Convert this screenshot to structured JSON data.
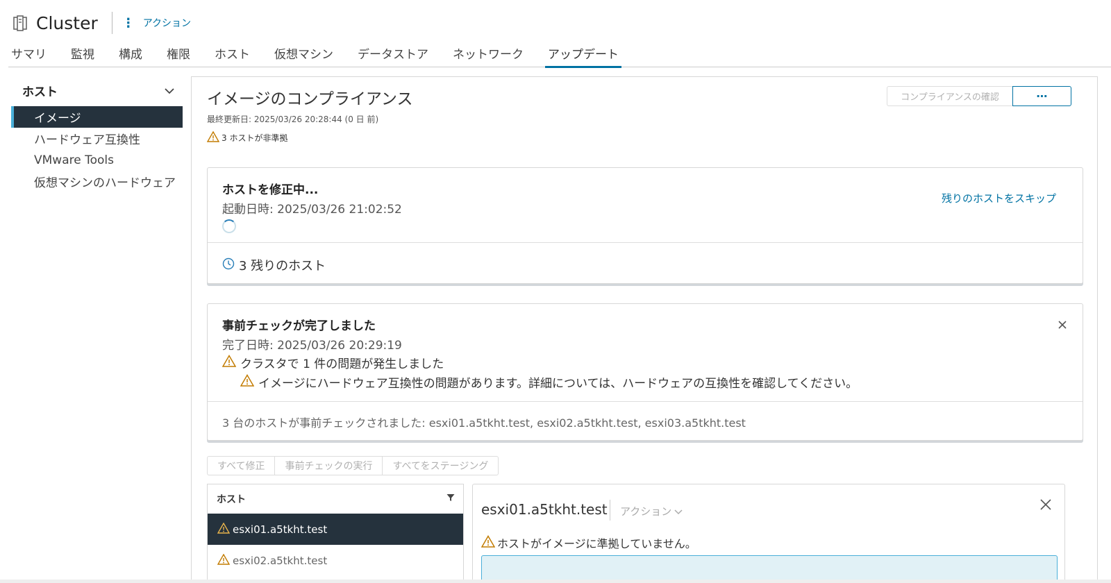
{
  "header": {
    "title": "Cluster",
    "actions_label": "アクション"
  },
  "tabs": [
    {
      "label": "サマリ"
    },
    {
      "label": "監視"
    },
    {
      "label": "構成"
    },
    {
      "label": "権限"
    },
    {
      "label": "ホスト"
    },
    {
      "label": "仮想マシン"
    },
    {
      "label": "データストア"
    },
    {
      "label": "ネットワーク"
    },
    {
      "label": "アップデート",
      "active": true
    }
  ],
  "sidebar": {
    "section_title": "ホスト",
    "items": [
      {
        "label": "イメージ",
        "active": true
      },
      {
        "label": "ハードウェア互換性"
      },
      {
        "label": "VMware Tools"
      },
      {
        "label": "仮想マシンのハードウェア"
      }
    ]
  },
  "main": {
    "title": "イメージのコンプライアンス",
    "last_updated": "最終更新日: 2025/03/26 20:28:44 (0 日 前)",
    "noncompliant": "3 ホストが非準拠",
    "check_button": "コンプライアンスの確認",
    "more_button": "⋯"
  },
  "remediation_card": {
    "title": "ホストを修正中...",
    "started": "起動日時: 2025/03/26 21:02:52",
    "skip_link": "残りのホストをスキップ",
    "remaining": "3 残りのホスト"
  },
  "precheck_card": {
    "title": "事前チェックが完了しました",
    "completed": "完了日時: 2025/03/26 20:29:19",
    "issue_summary": "クラスタで 1 件の問題が発生しました",
    "issue_detail": "イメージにハードウェア互換性の問題があります。詳細については、ハードウェアの互換性を確認してください。",
    "hosts_checked": "3 台のホストが事前チェックされました: esxi01.a5tkht.test, esxi02.a5tkht.test, esxi03.a5tkht.test"
  },
  "bulk_actions": {
    "remediate_all": "すべて修正",
    "run_precheck": "事前チェックの実行",
    "stage_all": "すべてをステージング"
  },
  "host_list": {
    "header": "ホスト",
    "rows": [
      {
        "name": "esxi01.a5tkht.test",
        "selected": true
      },
      {
        "name": "esxi02.a5tkht.test"
      }
    ]
  },
  "detail": {
    "host_name": "esxi01.a5tkht.test",
    "actions_label": "アクション",
    "message": "ホストがイメージに準拠していません。"
  },
  "colors": {
    "accent": "#0072a3",
    "selected_bg": "#25323d",
    "warning": "#c27b00"
  }
}
